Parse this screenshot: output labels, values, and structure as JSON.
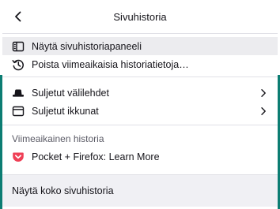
{
  "header": {
    "title": "Sivuhistoria"
  },
  "menu": {
    "items": [
      {
        "label": "Näytä sivuhistoriapaneeli",
        "icon": "sidebar-icon"
      },
      {
        "label": "Poista viimeaikaisia historiatietoja…",
        "icon": "history-icon"
      }
    ],
    "sub_items": [
      {
        "label": "Suljetut välilehdet",
        "icon": "closed-tabs-icon"
      },
      {
        "label": "Suljetut ikkunat",
        "icon": "window-icon"
      }
    ]
  },
  "recent": {
    "heading": "Viimeaikainen historia",
    "entries": [
      {
        "label": "Pocket + Firefox: Learn More",
        "icon": "pocket-icon"
      }
    ]
  },
  "footer": {
    "label": "Näytä koko sivuhistoria"
  },
  "colors": {
    "accent": "#0c7d73",
    "pocket": "#ef4056",
    "hover": "#ececef",
    "footer_bg": "#f0f0f4"
  }
}
